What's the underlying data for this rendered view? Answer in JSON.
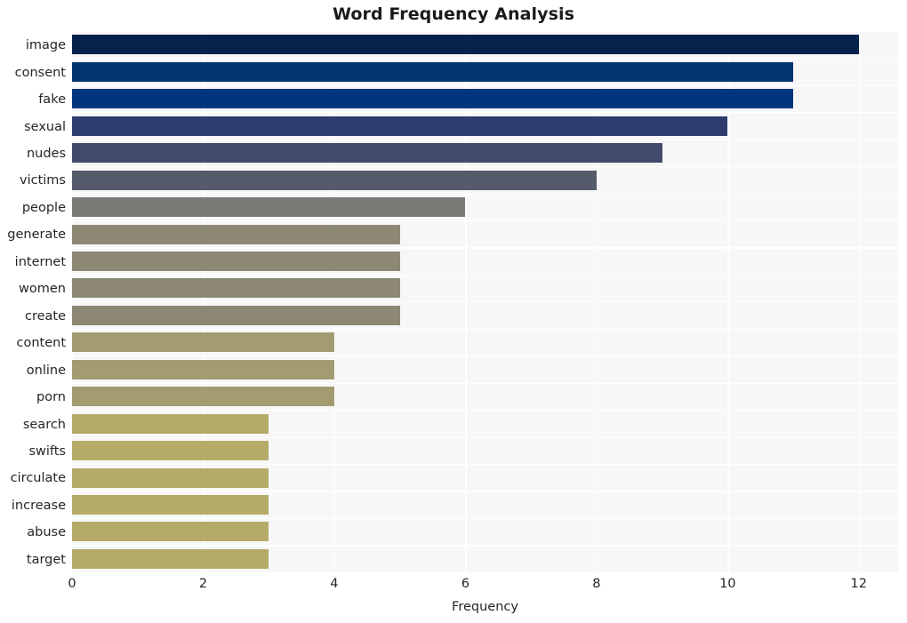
{
  "chart_data": {
    "type": "bar",
    "orientation": "horizontal",
    "title": "Word Frequency Analysis",
    "xlabel": "Frequency",
    "ylabel": "",
    "xlim": [
      0,
      12.6
    ],
    "ylim": [
      0,
      20
    ],
    "grid": true,
    "legend": null,
    "xticks": [
      "0",
      "2",
      "4",
      "6",
      "8",
      "10",
      "12"
    ],
    "xtick_values": [
      0,
      2,
      4,
      6,
      8,
      10,
      12
    ],
    "categories": [
      "image",
      "consent",
      "fake",
      "sexual",
      "nudes",
      "victims",
      "people",
      "generate",
      "internet",
      "women",
      "create",
      "content",
      "online",
      "porn",
      "search",
      "swifts",
      "circulate",
      "increase",
      "abuse",
      "target"
    ],
    "values": [
      12,
      11,
      11,
      10,
      9,
      8,
      6,
      5,
      5,
      5,
      5,
      4,
      4,
      4,
      3,
      3,
      3,
      3,
      3,
      3
    ],
    "bar_colors": [
      "#06214b",
      "#00356f",
      "#00377c",
      "#2d3d6d",
      "#414a69",
      "#565b6c",
      "#7a7a76",
      "#8d8875",
      "#8d8875",
      "#8d8875",
      "#8d8875",
      "#a39c70",
      "#a39c70",
      "#a39c70",
      "#b5ab68",
      "#b5ab68",
      "#b5ab68",
      "#b5ab68",
      "#b5ab68",
      "#b5ab68"
    ],
    "plot_background": "#f7f7f7",
    "gridline_color": "#ffffff",
    "figure_background": "#ffffff",
    "tick_label_color": "#262626",
    "title_color": "#1a1a1a"
  }
}
